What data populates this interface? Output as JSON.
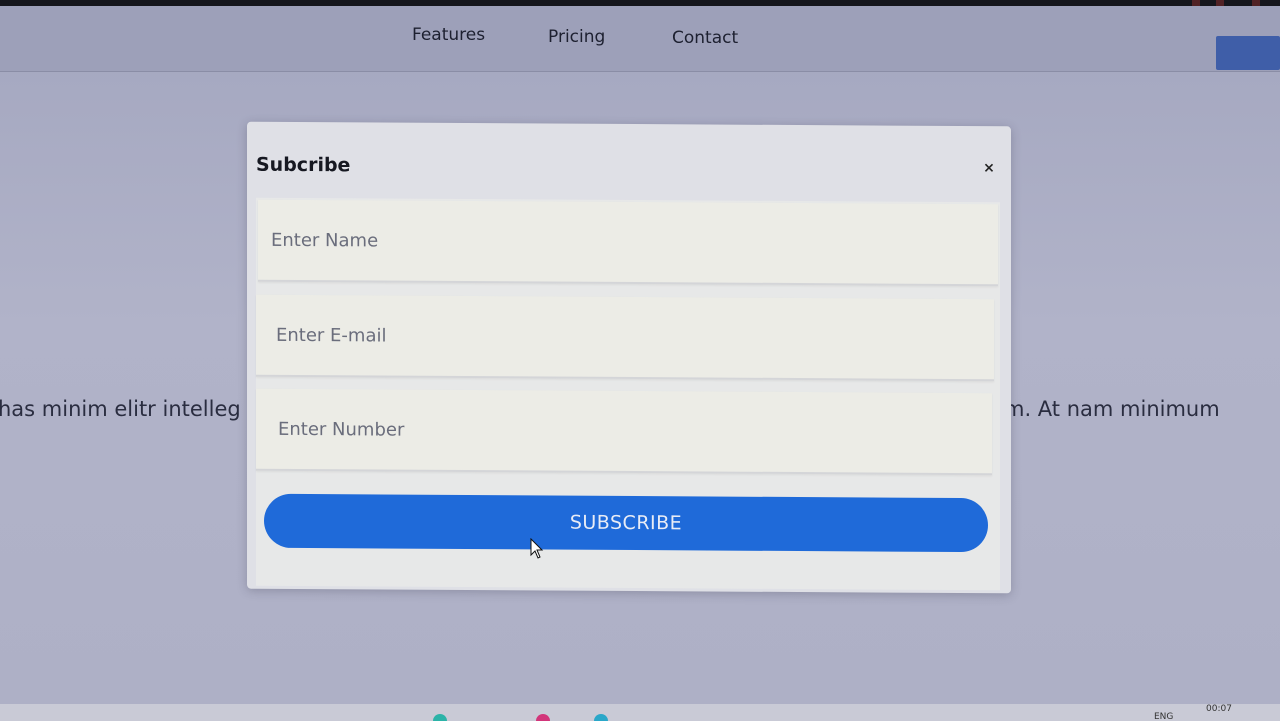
{
  "nav": {
    "links": [
      "Features",
      "Pricing",
      "Contact"
    ]
  },
  "background_text": {
    "left": "has minim elitr intelleg",
    "right": "m. At nam minimum"
  },
  "modal": {
    "title": "Subcribe",
    "close_symbol": "×",
    "fields": [
      {
        "placeholder": "Enter Name",
        "value": ""
      },
      {
        "placeholder": "Enter E-mail",
        "value": ""
      },
      {
        "placeholder": "Enter Number",
        "value": ""
      }
    ],
    "submit_label": "SUBSCRIBE"
  },
  "taskbar": {
    "clock": "00:07",
    "language": "ENG"
  },
  "colors": {
    "accent": "#1f6ad9",
    "overlay": "#a9acc4"
  }
}
